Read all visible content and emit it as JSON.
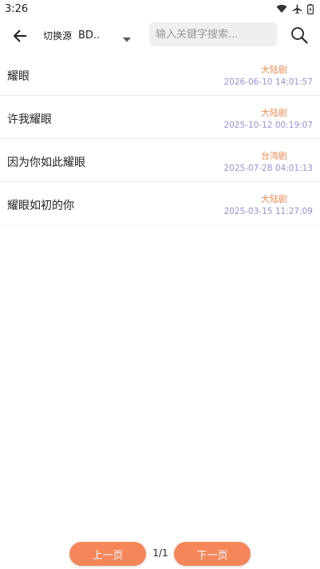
{
  "status_bar": {
    "time": "3:26",
    "icons": [
      "wifi-icon",
      "airplane-icon",
      "battery-icon"
    ]
  },
  "top_bar": {
    "switch_label": "切换源",
    "source_value": "BD..",
    "search_placeholder": "输入关键字搜索...",
    "search_value": "",
    "icons": [
      "back-arrow-icon",
      "dropdown-caret-icon",
      "search-icon"
    ]
  },
  "results": [
    {
      "title": "耀眼",
      "category": "大陆剧",
      "time": "2026-06-10 14:01:57"
    },
    {
      "title": "许我耀眼",
      "category": "大陆剧",
      "time": "2025-10-12 00:19:07"
    },
    {
      "title": "因为你如此耀眼",
      "category": "台湾剧",
      "time": "2025-07-28 04:01:13"
    },
    {
      "title": "耀眼如初的你",
      "category": "大陆剧",
      "time": "2025-03-15 11:27:09"
    }
  ],
  "pager": {
    "prev_label": "上一页",
    "next_label": "下一页",
    "indicator": "1/1"
  },
  "colors": {
    "accent": "#f4865a",
    "category": "#f08a54",
    "timestamp": "#9a8fd4",
    "search_bg": "#efefef"
  }
}
